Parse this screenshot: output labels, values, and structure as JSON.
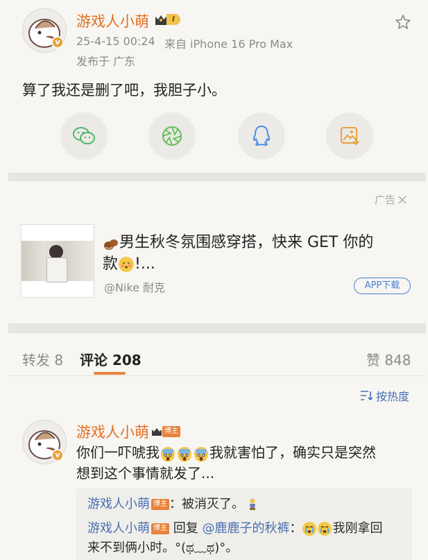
{
  "post": {
    "author": "游戏人小萌",
    "level_badge": "I",
    "timestamp": "25-4-15 00:24",
    "source": "来自 iPhone 16 Pro Max",
    "location": "发布于 广东",
    "text": "算了我还是删了吧，我胆子小。"
  },
  "share": [
    {
      "name": "wechat-icon",
      "color": "#4ab96a"
    },
    {
      "name": "moments-icon",
      "color": "#5fbf56"
    },
    {
      "name": "qq-icon",
      "color": "#4a8be8"
    },
    {
      "name": "save-image-icon",
      "color": "#e8a23a"
    }
  ],
  "ad": {
    "label": "广告",
    "title_line1": "男生秋冬氛围感穿搭，快来 GET 你的",
    "title_line2": "款",
    "title_suffix": "!...",
    "brand": "@Nike 耐克",
    "cta": "APP下载"
  },
  "tabs": {
    "repost": "转发 8",
    "comments": "评论 208",
    "likes": "赞 848"
  },
  "sort": {
    "label": "按热度"
  },
  "comment": {
    "author": "游戏人小萌",
    "role": "博主",
    "text_part1": "你们一吓唬我",
    "text_part2": "我就害怕了，确实只是突然",
    "text_line2": "想到这个事情就发了...",
    "replies": [
      {
        "author": "游戏人小萌",
        "role": "博主",
        "text": "：被消灭了。"
      },
      {
        "author": "游戏人小萌",
        "role": "博主",
        "prefix": "回复",
        "mention": "@鹿鹿子的秋裤",
        "text": "：",
        "text2": "我刚拿回",
        "text_line2": "来不到俩小时。°(ಥ﹏ಥ)°。"
      }
    ]
  }
}
